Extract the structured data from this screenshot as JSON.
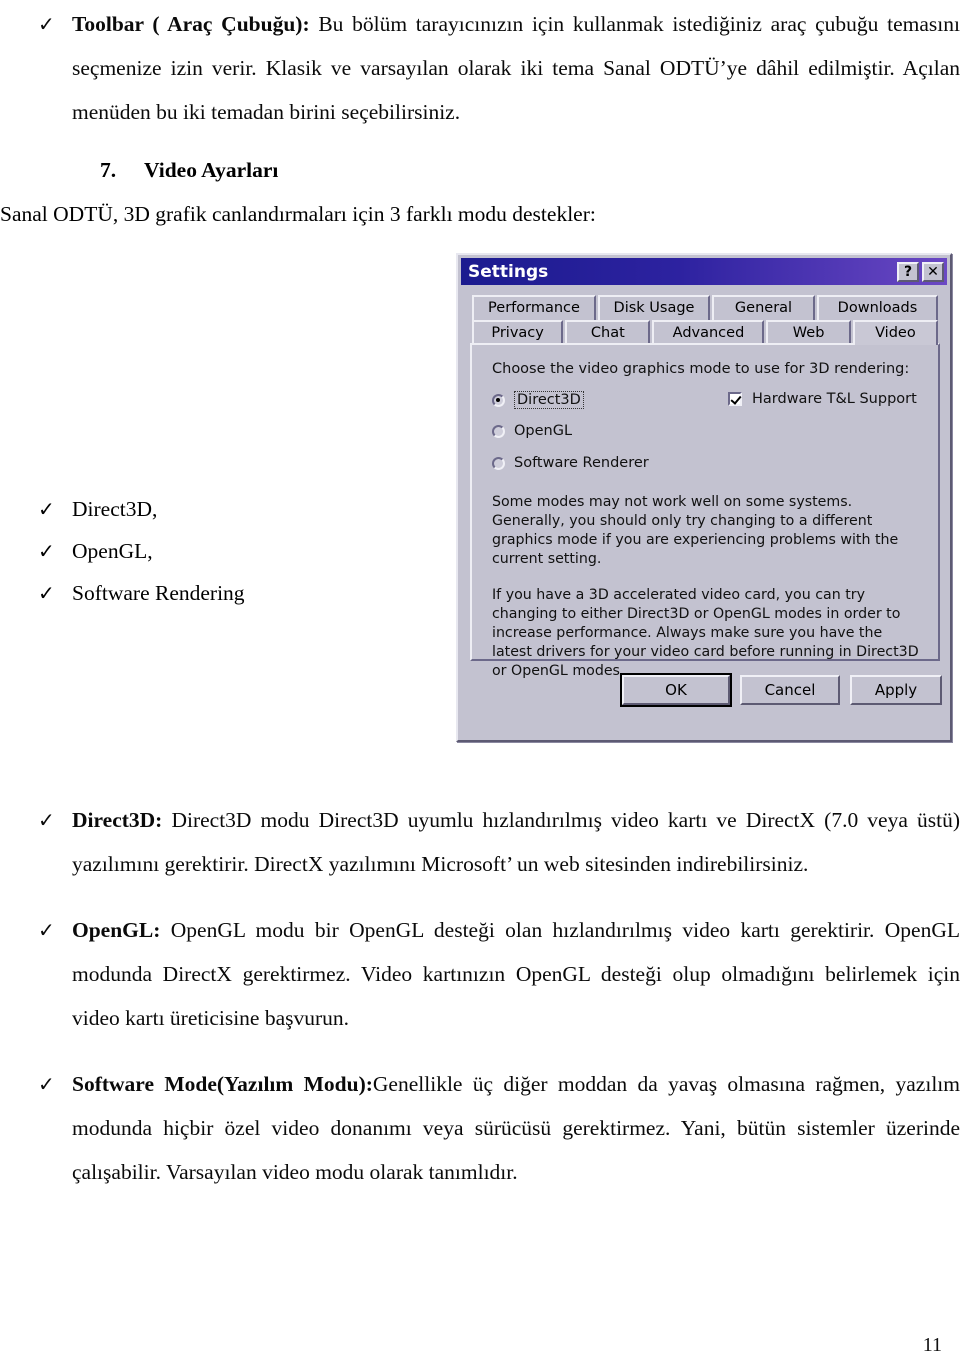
{
  "document": {
    "paragraphs": [
      {
        "bullet": "✓",
        "bold_lead": "Toolbar ( Araç Çubuğu):",
        "text": " Bu bölüm tarayıcınızın için kullanmak istediğiniz araç çubuğu temasını seçmenize izin verir. Klasik ve varsayılan olarak iki tema Sanal ODTÜ’ye dâhil edilmiştir. Açılan menüden bu iki temadan birini seçebilirsiniz."
      }
    ],
    "heading": {
      "number": "7.",
      "title": "Video Ayarları"
    },
    "intro_line": "Sanal ODTÜ, 3D grafik canlandırmaları için 3 farklı modu destekler:",
    "mode_list": [
      {
        "bullet": "✓",
        "label": "Direct3D,"
      },
      {
        "bullet": "✓",
        "label": "OpenGL,"
      },
      {
        "bullet": "✓",
        "label": "Software Rendering"
      }
    ],
    "detail_paragraphs": [
      {
        "bullet": "✓",
        "bold_lead": "Direct3D:",
        "text": " Direct3D modu Direct3D uyumlu hızlandırılmış video kartı ve DirectX (7.0 veya üstü) yazılımını gerektirir. DirectX yazılımını Microsoft’ un web sitesinden indirebilirsiniz."
      },
      {
        "bullet": "✓",
        "bold_lead": "OpenGL:",
        "text": " OpenGL modu bir OpenGL desteği olan hızlandırılmış video kartı gerektirir. OpenGL modunda DirectX gerektirmez. Video kartınızın OpenGL desteği olup olmadığını belirlemek için video kartı üreticisine başvurun."
      },
      {
        "bullet": "✓",
        "bold_lead": "Software Mode(Yazılım Modu):",
        "text": "Genellikle üç diğer moddan da yavaş olmasına rağmen, yazılım modunda hiçbir özel video donanımı veya sürücüsü gerektirmez. Yani, bütün sistemler üzerinde çalışabilir. Varsayılan video modu olarak tanımlıdır."
      }
    ],
    "page_number": "11"
  },
  "dialog": {
    "title": "Settings",
    "titlebar_buttons": [
      {
        "name": "help-button",
        "glyph": "?"
      },
      {
        "name": "close-button",
        "glyph": "✕"
      }
    ],
    "tabs_row1": [
      {
        "label": "Performance",
        "active": false
      },
      {
        "label": "Disk Usage",
        "active": false
      },
      {
        "label": "General",
        "active": false
      },
      {
        "label": "Downloads",
        "active": false
      }
    ],
    "tabs_row2": [
      {
        "label": "Privacy",
        "active": false
      },
      {
        "label": "Chat",
        "active": false
      },
      {
        "label": "Advanced",
        "active": false
      },
      {
        "label": "Web",
        "active": false
      },
      {
        "label": "Video",
        "active": true
      }
    ],
    "prompt": "Choose the video graphics mode to use for 3D rendering:",
    "radios": [
      {
        "label": "Direct3D",
        "selected": true,
        "focused": true
      },
      {
        "label": "OpenGL",
        "selected": false,
        "focused": false
      },
      {
        "label": "Software Renderer",
        "selected": false,
        "focused": false
      }
    ],
    "checkbox": {
      "label": "Hardware T&L Support",
      "checked": true
    },
    "help_paragraphs": [
      "Some modes may not work well on some systems.  Generally, you should only try changing to a different graphics mode if you are experiencing problems with the current setting.",
      "If you have a 3D accelerated video card, you can try changing to either Direct3D or OpenGL modes in order to increase performance.  Always make sure you have the latest drivers for your video card before running in Direct3D or OpenGL modes."
    ],
    "buttons": [
      {
        "label": "OK",
        "default": true
      },
      {
        "label": "Cancel",
        "default": false
      },
      {
        "label": "Apply",
        "default": false,
        "accel": "A"
      }
    ],
    "colors": {
      "face": "#c3c2d0",
      "titlebar_left": "#1b1b8f",
      "titlebar_right": "#6b48c4",
      "shadow": "#5d5a73",
      "highlight": "#eeeef4"
    }
  }
}
